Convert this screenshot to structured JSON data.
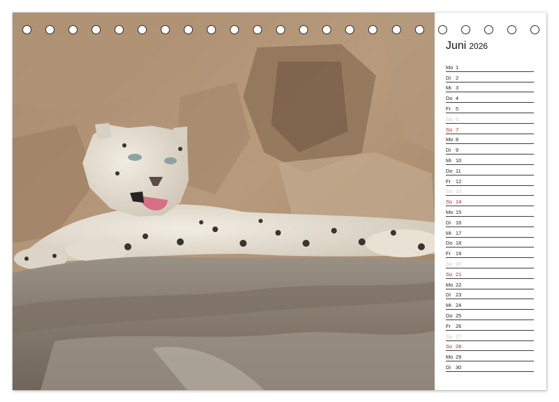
{
  "calendar": {
    "month": "Juni",
    "year": "2026",
    "days": [
      {
        "wd": "Mo",
        "d": "1",
        "type": "normal"
      },
      {
        "wd": "Di",
        "d": "2",
        "type": "normal"
      },
      {
        "wd": "Mi",
        "d": "3",
        "type": "normal"
      },
      {
        "wd": "Do",
        "d": "4",
        "type": "normal"
      },
      {
        "wd": "Fr",
        "d": "5",
        "type": "normal"
      },
      {
        "wd": "Sa",
        "d": "6",
        "type": "sat"
      },
      {
        "wd": "So",
        "d": "7",
        "type": "sun"
      },
      {
        "wd": "Mo",
        "d": "8",
        "type": "normal"
      },
      {
        "wd": "Di",
        "d": "9",
        "type": "normal"
      },
      {
        "wd": "Mi",
        "d": "10",
        "type": "normal"
      },
      {
        "wd": "Do",
        "d": "11",
        "type": "normal"
      },
      {
        "wd": "Fr",
        "d": "12",
        "type": "normal"
      },
      {
        "wd": "Sa",
        "d": "13",
        "type": "sat"
      },
      {
        "wd": "So",
        "d": "14",
        "type": "sun"
      },
      {
        "wd": "Mo",
        "d": "15",
        "type": "normal"
      },
      {
        "wd": "Di",
        "d": "16",
        "type": "normal"
      },
      {
        "wd": "Mi",
        "d": "17",
        "type": "normal"
      },
      {
        "wd": "Do",
        "d": "18",
        "type": "normal"
      },
      {
        "wd": "Fr",
        "d": "19",
        "type": "normal"
      },
      {
        "wd": "Sa",
        "d": "20",
        "type": "sat"
      },
      {
        "wd": "So",
        "d": "21",
        "type": "sun"
      },
      {
        "wd": "Mo",
        "d": "22",
        "type": "normal"
      },
      {
        "wd": "Di",
        "d": "23",
        "type": "normal"
      },
      {
        "wd": "Mi",
        "d": "24",
        "type": "normal"
      },
      {
        "wd": "Do",
        "d": "25",
        "type": "normal"
      },
      {
        "wd": "Fr",
        "d": "26",
        "type": "normal"
      },
      {
        "wd": "Sa",
        "d": "27",
        "type": "sat"
      },
      {
        "wd": "So",
        "d": "28",
        "type": "sun"
      },
      {
        "wd": "Mo",
        "d": "29",
        "type": "normal"
      },
      {
        "wd": "Di",
        "d": "30",
        "type": "normal"
      }
    ]
  },
  "colors": {
    "sunday": "#b02525",
    "saturday": "#c9c9c9",
    "rule": "#3a3a3a"
  },
  "photo": {
    "subject_icon": "snow-leopard-photo"
  }
}
